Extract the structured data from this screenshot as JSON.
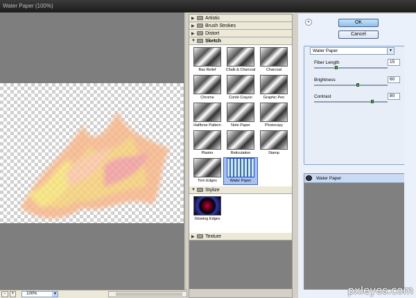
{
  "window": {
    "title": "Water Paper (100%)"
  },
  "status": {
    "zoom": "100%"
  },
  "gallery": {
    "categories": [
      {
        "label": "Artistic",
        "expanded": false
      },
      {
        "label": "Brush Strokes",
        "expanded": false
      },
      {
        "label": "Distort",
        "expanded": false
      },
      {
        "label": "Sketch",
        "expanded": true
      },
      {
        "label": "Stylize",
        "expanded": true
      },
      {
        "label": "Texture",
        "expanded": false
      }
    ],
    "sketch_filters": [
      "Bas Relief",
      "Chalk & Charcoal",
      "Charcoal",
      "Chrome",
      "Conté Crayon",
      "Graphic Pen",
      "Halftone Pattern",
      "Note Paper",
      "Photocopy",
      "Plaster",
      "Reticulation",
      "Stamp",
      "Torn Edges",
      "Water Paper"
    ],
    "stylize_filters": [
      "Glowing Edges"
    ],
    "selected": "Water Paper"
  },
  "buttons": {
    "ok": "OK",
    "cancel": "Cancel"
  },
  "settings": {
    "filter": "Water Paper",
    "params": [
      {
        "label": "Fiber Length",
        "value": "15",
        "fraction": 0.29
      },
      {
        "label": "Brightness",
        "value": "60",
        "fraction": 0.6
      },
      {
        "label": "Contrast",
        "value": "80",
        "fraction": 0.8
      }
    ]
  },
  "layers": {
    "current": "Water Paper"
  },
  "watermark": "pxleyes.com",
  "colors": {
    "preview_bg": "#7e7e7e",
    "panel_bg": "#eaf1fa",
    "selection": "#a8c2ee"
  }
}
